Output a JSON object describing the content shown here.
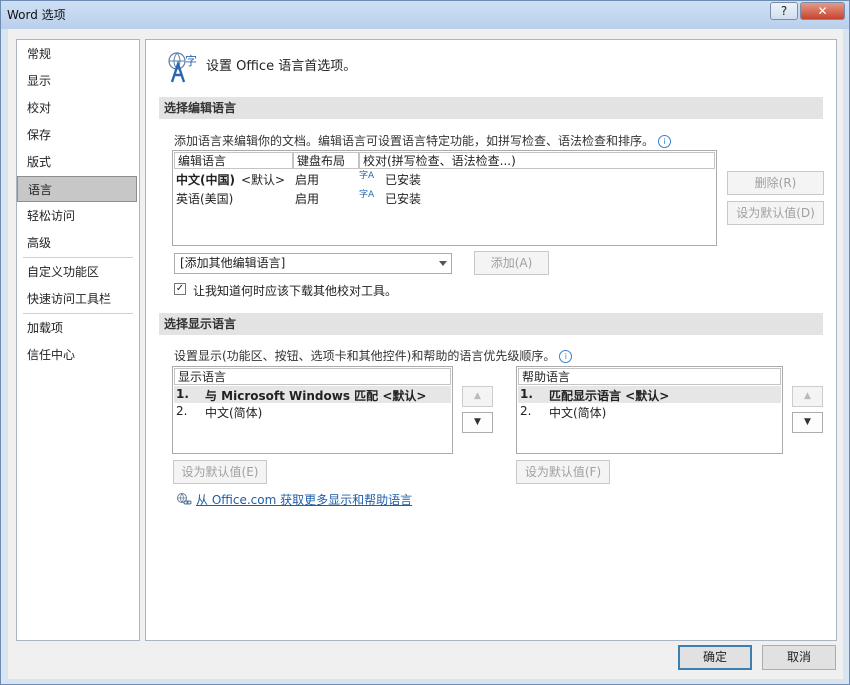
{
  "window": {
    "title": "Word 选项",
    "help_label": "?",
    "close_label": "✕"
  },
  "nav": {
    "items": [
      "常规",
      "显示",
      "校对",
      "保存",
      "版式",
      "语言",
      "轻松访问",
      "高级",
      "自定义功能区",
      "快速访问工具栏",
      "加载项",
      "信任中心"
    ],
    "selected": "语言"
  },
  "header": {
    "icon_label": "字",
    "title": "设置 Office 语言首选项。"
  },
  "editing": {
    "section_title": "选择编辑语言",
    "description": "添加语言来编辑你的文档。编辑语言可设置语言特定功能，如拼写检查、语法检查和排序。",
    "columns": [
      "编辑语言",
      "键盘布局",
      "校对(拼写检查、语法检查...)"
    ],
    "rows": [
      {
        "language": "中文(中国)",
        "default_tag": "<默认>",
        "keyboard": "启用",
        "proofing_icon": "字A",
        "proofing": "已安装"
      },
      {
        "language": "英语(美国)",
        "default_tag": "",
        "keyboard": "启用",
        "proofing_icon": "字A",
        "proofing": "已安装"
      }
    ],
    "remove_label": "删除(R)",
    "set_default_label": "设为默认值(D)",
    "add_dropdown": "[添加其他编辑语言]",
    "add_label": "添加(A)",
    "checkbox_checked": true,
    "checkbox_label": "让我知道何时应该下载其他校对工具。"
  },
  "display": {
    "section_title": "选择显示语言",
    "description": "设置显示(功能区、按钮、选项卡和其他控件)和帮助的语言优先级顺序。",
    "display_header": "显示语言",
    "display_rows": [
      {
        "num": "1.",
        "text": "与 Microsoft Windows 匹配 <默认>"
      },
      {
        "num": "2.",
        "text": "中文(简体)"
      }
    ],
    "help_header": "帮助语言",
    "help_rows": [
      {
        "num": "1.",
        "text": "匹配显示语言 <默认>"
      },
      {
        "num": "2.",
        "text": "中文(简体)"
      }
    ],
    "set_default_display_label": "设为默认值(E)",
    "set_default_help_label": "设为默认值(F)",
    "up_glyph": "▲",
    "down_glyph": "▼",
    "link_text": "从 Office.com 获取更多显示和帮助语言"
  },
  "footer": {
    "ok_label": "确定",
    "cancel_label": "取消"
  }
}
